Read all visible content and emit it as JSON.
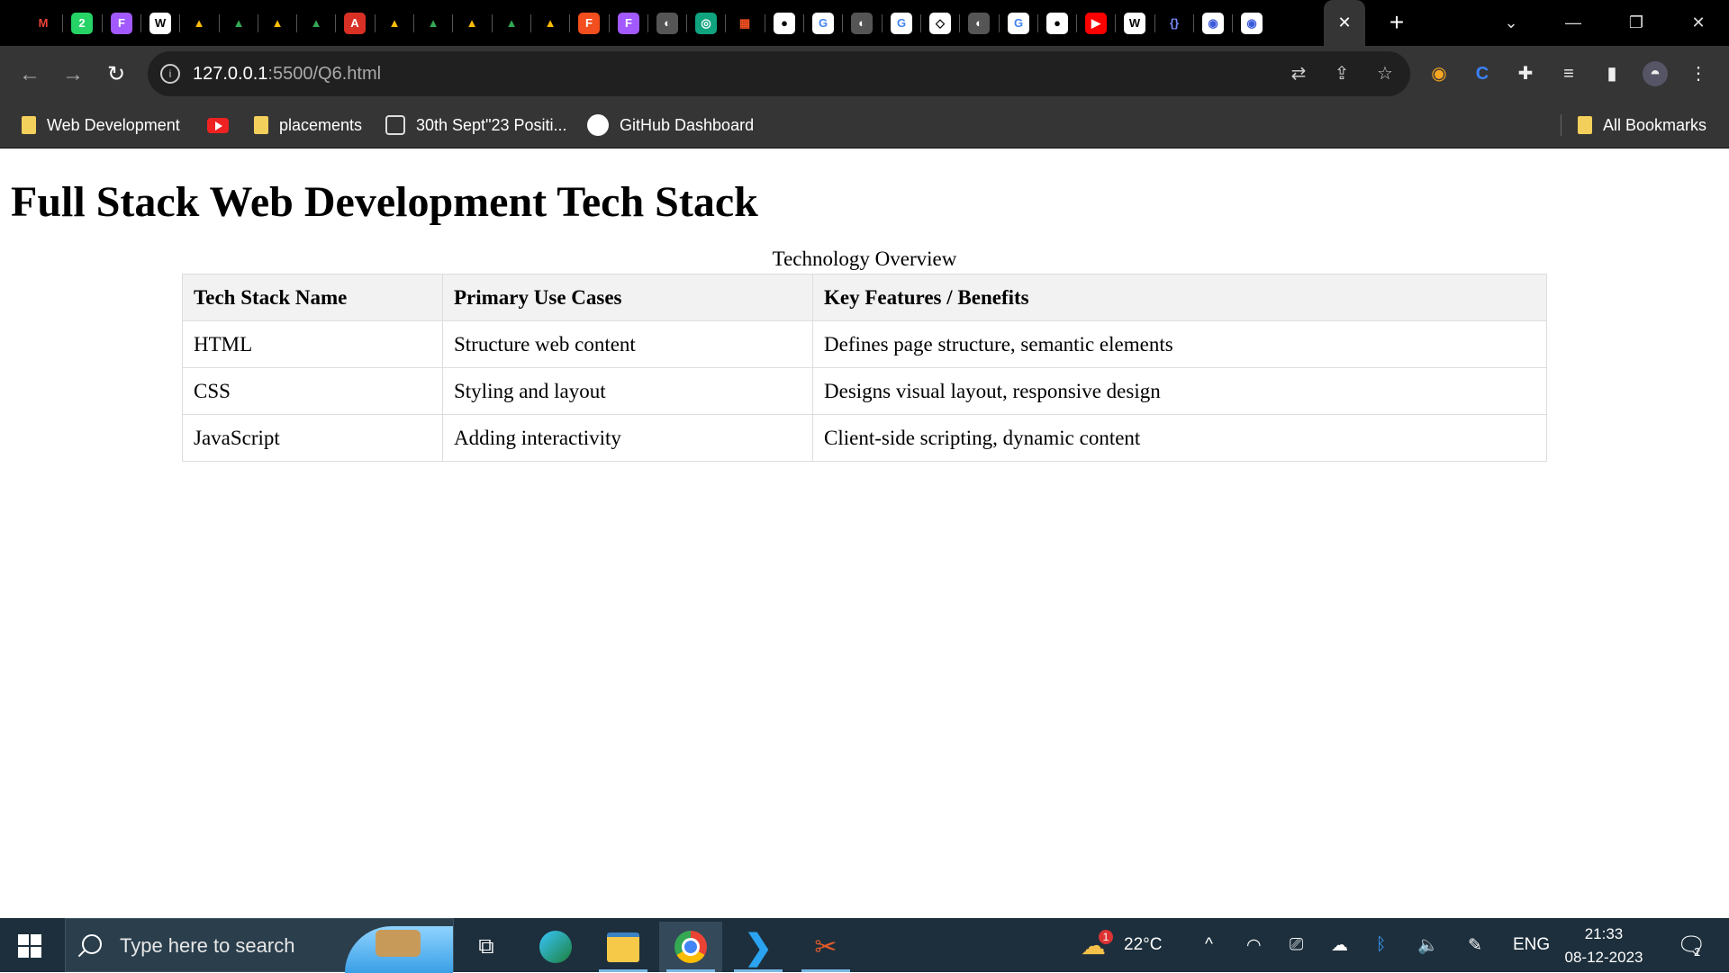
{
  "browser": {
    "tabs": [
      {
        "icon": "gmail-icon",
        "glyph": "M",
        "bg": "#000000",
        "fg": "#ea4335"
      },
      {
        "icon": "whatsapp-icon",
        "glyph": "2",
        "bg": "#25d366",
        "fg": "#ffffff"
      },
      {
        "icon": "figma-icon",
        "glyph": "F",
        "bg": "#a259ff",
        "fg": "#ffffff"
      },
      {
        "icon": "wordpress-icon",
        "glyph": "W",
        "bg": "#ffffff",
        "fg": "#000000"
      },
      {
        "icon": "google-drive-icon",
        "glyph": "▲",
        "bg": "#000000",
        "fg": "#fbbc04"
      },
      {
        "icon": "google-drive-icon",
        "glyph": "▲",
        "bg": "#000000",
        "fg": "#34a853"
      },
      {
        "icon": "google-drive-icon",
        "glyph": "▲",
        "bg": "#000000",
        "fg": "#fbbc04"
      },
      {
        "icon": "google-drive-icon",
        "glyph": "▲",
        "bg": "#000000",
        "fg": "#34a853"
      },
      {
        "icon": "pdf-icon",
        "glyph": "A",
        "bg": "#d93025",
        "fg": "#ffffff"
      },
      {
        "icon": "google-drive-icon",
        "glyph": "▲",
        "bg": "#000000",
        "fg": "#fbbc04"
      },
      {
        "icon": "google-drive-icon",
        "glyph": "▲",
        "bg": "#000000",
        "fg": "#34a853"
      },
      {
        "icon": "google-drive-icon",
        "glyph": "▲",
        "bg": "#000000",
        "fg": "#fbbc04"
      },
      {
        "icon": "google-drive-icon",
        "glyph": "▲",
        "bg": "#000000",
        "fg": "#34a853"
      },
      {
        "icon": "google-drive-icon",
        "glyph": "▲",
        "bg": "#000000",
        "fg": "#fbbc04"
      },
      {
        "icon": "figma-icon",
        "glyph": "F",
        "bg": "#f24e1e",
        "fg": "#ffffff"
      },
      {
        "icon": "figma-icon",
        "glyph": "F",
        "bg": "#a259ff",
        "fg": "#ffffff"
      },
      {
        "icon": "globe-icon",
        "glyph": "◐",
        "bg": "#555555",
        "fg": "#ffffff"
      },
      {
        "icon": "chatgpt-icon",
        "glyph": "◎",
        "bg": "#10a37f",
        "fg": "#ffffff"
      },
      {
        "icon": "microsoft-icon",
        "glyph": "▦",
        "bg": "#000000",
        "fg": "#f25022"
      },
      {
        "icon": "github-icon",
        "glyph": "●",
        "bg": "#ffffff",
        "fg": "#000000"
      },
      {
        "icon": "google-icon",
        "glyph": "G",
        "bg": "#ffffff",
        "fg": "#4285f4"
      },
      {
        "icon": "globe-icon",
        "glyph": "◐",
        "bg": "#555555",
        "fg": "#ffffff"
      },
      {
        "icon": "google-icon",
        "glyph": "G",
        "bg": "#ffffff",
        "fg": "#4285f4"
      },
      {
        "icon": "codepen-icon",
        "glyph": "◇",
        "bg": "#ffffff",
        "fg": "#000000"
      },
      {
        "icon": "globe-icon",
        "glyph": "◐",
        "bg": "#555555",
        "fg": "#ffffff"
      },
      {
        "icon": "google-icon",
        "glyph": "G",
        "bg": "#ffffff",
        "fg": "#4285f4"
      },
      {
        "icon": "github-icon",
        "glyph": "●",
        "bg": "#ffffff",
        "fg": "#000000"
      },
      {
        "icon": "youtube-icon",
        "glyph": "▶",
        "bg": "#ff0000",
        "fg": "#ffffff"
      },
      {
        "icon": "wordpress-icon",
        "glyph": "W",
        "bg": "#ffffff",
        "fg": "#000000"
      },
      {
        "icon": "regex-icon",
        "glyph": "{}",
        "bg": "#000000",
        "fg": "#7b8cff"
      },
      {
        "icon": "firebase-icon",
        "glyph": "◉",
        "bg": "#ffffff",
        "fg": "#3b5bdb"
      },
      {
        "icon": "firebase-icon",
        "glyph": "◉",
        "bg": "#ffffff",
        "fg": "#3b5bdb"
      }
    ],
    "active_tab_close": "✕",
    "new_tab": "+",
    "url_host": "127.0.0.1",
    "url_path": ":5500/Q6.html",
    "bookmarks": [
      {
        "label": "Web Development",
        "icon": "folder-icon"
      },
      {
        "label": "",
        "icon": "youtube-icon"
      },
      {
        "label": "placements",
        "icon": "folder-icon"
      },
      {
        "label": "30th Sept\"23 Positi...",
        "icon": "wordpress-icon"
      },
      {
        "label": "GitHub Dashboard",
        "icon": "github-icon"
      }
    ],
    "all_bookmarks": "All Bookmarks"
  },
  "page": {
    "heading": "Full Stack Web Development Tech Stack",
    "table": {
      "caption": "Technology Overview",
      "headers": [
        "Tech Stack Name",
        "Primary Use Cases",
        "Key Features / Benefits"
      ],
      "rows": [
        [
          "HTML",
          "Structure web content",
          "Defines page structure, semantic elements"
        ],
        [
          "CSS",
          "Styling and layout",
          "Designs visual layout, responsive design"
        ],
        [
          "JavaScript",
          "Adding interactivity",
          "Client-side scripting, dynamic content"
        ]
      ]
    }
  },
  "taskbar": {
    "search_placeholder": "Type here to search",
    "weather_temp": "22°C",
    "weather_badge": "1",
    "language": "ENG",
    "time": "21:33",
    "date": "08-12-2023",
    "notification_count": "2"
  }
}
